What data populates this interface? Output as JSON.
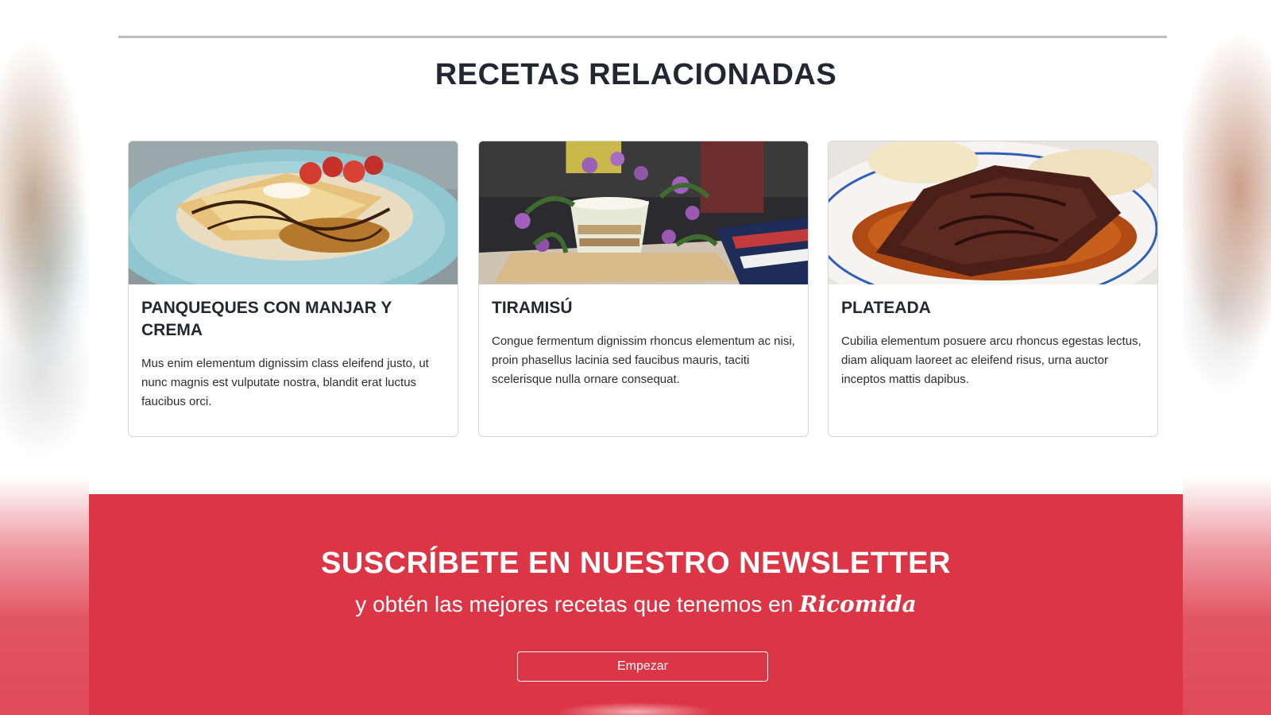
{
  "related": {
    "title": "RECETAS RELACIONADAS",
    "cards": [
      {
        "title": "PANQUEQUES CON MANJAR Y CREMA",
        "text": "Mus enim elementum dignissim class eleifend justo, ut nunc magnis est vulputate nostra, blandit erat luctus faucibus orci."
      },
      {
        "title": "TIRAMISÚ",
        "text": "Congue fermentum dignissim rhoncus elementum ac nisi, proin phasellus lacinia sed faucibus mauris, taciti scelerisque nulla ornare consequat."
      },
      {
        "title": "PLATEADA",
        "text": "Cubilia elementum posuere arcu rhoncus egestas lectus, diam aliquam laoreet ac eleifend risus, urna auctor inceptos mattis dapibus."
      }
    ]
  },
  "newsletter": {
    "title": "SUSCRÍBETE EN NUESTRO NEWSLETTER",
    "subtitle": "y obtén las mejores recetas que tenemos en",
    "brand": "Ricomida",
    "button": "Empezar"
  },
  "colors": {
    "accent": "#dc3545",
    "text": "#222831",
    "border": "#d6d6d6"
  }
}
